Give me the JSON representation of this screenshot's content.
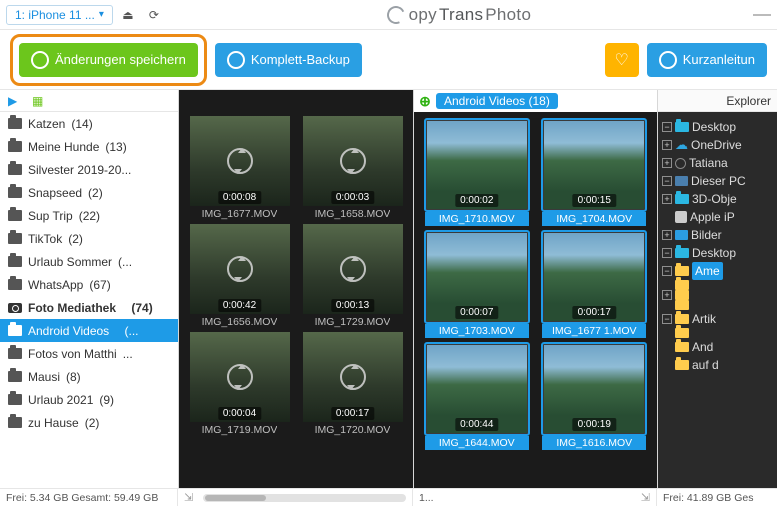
{
  "topbar": {
    "device": "1: iPhone 11 ...",
    "brand_prefix": "opy",
    "brand_mid": "Trans",
    "brand_suffix": " Photo"
  },
  "toolbar": {
    "save": "Änderungen speichern",
    "backup": "Komplett-Backup",
    "guide": "Kurzanleitun"
  },
  "albums": [
    {
      "name": "Katzen",
      "count": "(14)"
    },
    {
      "name": "Meine Hunde",
      "count": "(13)"
    },
    {
      "name": "Silvester 2019-20...",
      "count": ""
    },
    {
      "name": "Snapseed",
      "count": "(2)"
    },
    {
      "name": "Sup Trip",
      "count": "(22)"
    },
    {
      "name": "TikTok",
      "count": "(2)"
    },
    {
      "name": "Urlaub Sommer",
      "count": "(..."
    },
    {
      "name": "WhatsApp",
      "count": "(67)"
    }
  ],
  "photo_lib": {
    "name": "Foto Mediathek",
    "count": "(74)"
  },
  "album_selected": {
    "name": "Android Videos",
    "count": "(..."
  },
  "albums_after": [
    {
      "name": "Fotos von Matthi",
      "count": "..."
    },
    {
      "name": "Mausi",
      "count": "(8)"
    },
    {
      "name": "Urlaub 2021",
      "count": "(9)"
    },
    {
      "name": "zu Hause",
      "count": "(2)"
    }
  ],
  "device_thumbs": [
    {
      "dur": "0:00:08",
      "name": "IMG_1677.MOV"
    },
    {
      "dur": "0:00:03",
      "name": "IMG_1658.MOV"
    },
    {
      "dur": "0:00:42",
      "name": "IMG_1656.MOV"
    },
    {
      "dur": "0:00:13",
      "name": "IMG_1729.MOV"
    },
    {
      "dur": "0:00:04",
      "name": "IMG_1719.MOV"
    },
    {
      "dur": "0:00:17",
      "name": "IMG_1720.MOV"
    }
  ],
  "browse_header": "Android Videos (18)",
  "browse_thumbs": [
    {
      "dur": "0:00:02",
      "name": "IMG_1710.MOV"
    },
    {
      "dur": "0:00:15",
      "name": "IMG_1704.MOV"
    },
    {
      "dur": "0:00:07",
      "name": "IMG_1703.MOV"
    },
    {
      "dur": "0:00:17",
      "name": "IMG_1677 1.MOV"
    },
    {
      "dur": "0:00:44",
      "name": "IMG_1644.MOV"
    },
    {
      "dur": "0:00:19",
      "name": "IMG_1616.MOV"
    }
  ],
  "explorer_tab": "Explorer",
  "tree": {
    "desktop": "Desktop",
    "onedrive": "OneDrive",
    "tatiana": "Tatiana",
    "pc": "Dieser PC",
    "d3d": "3D-Obje",
    "apple": "Apple iP",
    "bilder": "Bilder",
    "desktop2": "Desktop",
    "ame": "Ame",
    "artik": "Artik",
    "and": "And",
    "auf": "auf d"
  },
  "status": {
    "albums": "Frei: 5.34 GB Gesamt: 59.49 GB",
    "browse": "1...",
    "explorer": "Frei: 41.89 GB Ges"
  }
}
